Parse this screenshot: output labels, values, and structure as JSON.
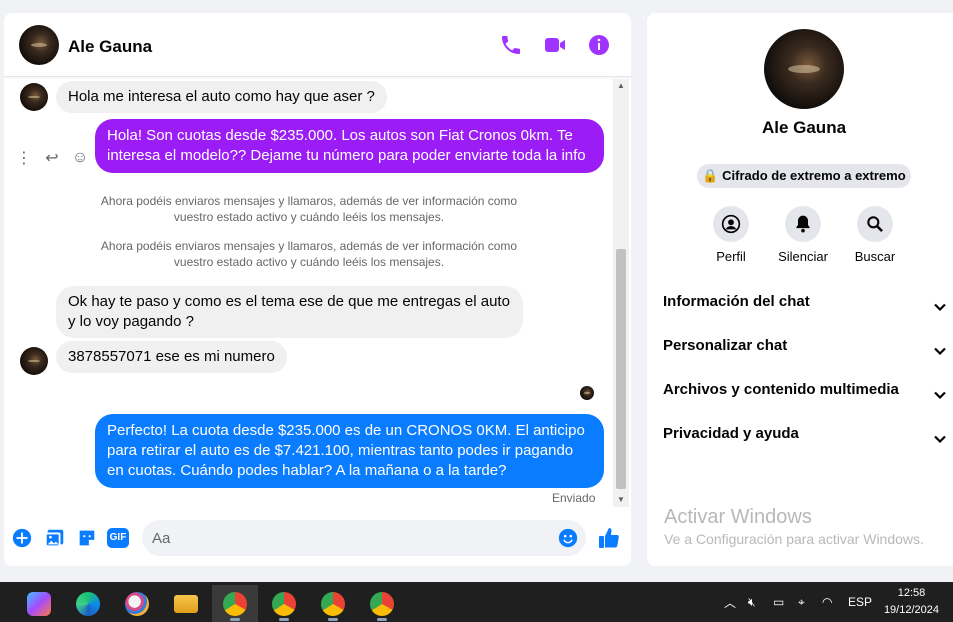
{
  "chat": {
    "contact_name": "Ale Gauna",
    "messages": [
      {
        "from": "in",
        "text": "Hola me interesa el auto como hay que aser ?"
      },
      {
        "from": "out",
        "text": "Hola! Son cuotas desde $235.000. Los autos son Fiat Cronos 0km. Te interesa el modelo?? Dejame tu número para poder enviarte toda la info"
      },
      {
        "from": "system",
        "text": "Ahora podéis enviaros mensajes y llamaros, además de ver información como vuestro estado activo y cuándo leéis los mensajes."
      },
      {
        "from": "system",
        "text": "Ahora podéis enviaros mensajes y llamaros, además de ver información como vuestro estado activo y cuándo leéis los mensajes."
      },
      {
        "from": "in",
        "text": "Ok hay te paso y como es el tema ese de que me entregas el auto y lo voy pagando ?"
      },
      {
        "from": "in",
        "text": "3878557071 ese es mi numero"
      },
      {
        "from": "out",
        "text": "Perfecto! La cuota desde $235.000 es de un CRONOS 0KM. El anticipo para retirar el auto es de $7.421.100, mientras tanto podes ir pagando en cuotas. Cuándo podes hablar? A la mañana o a la tarde?"
      }
    ],
    "sent_status": "Enviado",
    "composer_placeholder": "Aa",
    "composer_gif": "GIF",
    "colors": {
      "accent": "#a033ff",
      "bubble_purple": "#9b1cf5",
      "bubble_blue": "#0a7cff"
    }
  },
  "info": {
    "name": "Ale Gauna",
    "encryption": "Cifrado de extremo a extremo",
    "actions": [
      "Perfil",
      "Silenciar",
      "Buscar"
    ],
    "sections": [
      "Información del chat",
      "Personalizar chat",
      "Archivos y contenido multimedia",
      "Privacidad y ayuda"
    ],
    "watermark_title": "Activar Windows",
    "watermark_sub": "Ve a Configuración para activar Windows."
  },
  "taskbar": {
    "tray_lang": "ESP",
    "time": "12:58",
    "date": "19/12/2024",
    "apps": [
      "copilot-icon",
      "edge-icon",
      "paint-icon",
      "file-explorer-icon",
      "chrome-icon",
      "chrome-profile-icon",
      "chrome-profile-v-icon",
      "chrome-profile-t-icon"
    ]
  }
}
